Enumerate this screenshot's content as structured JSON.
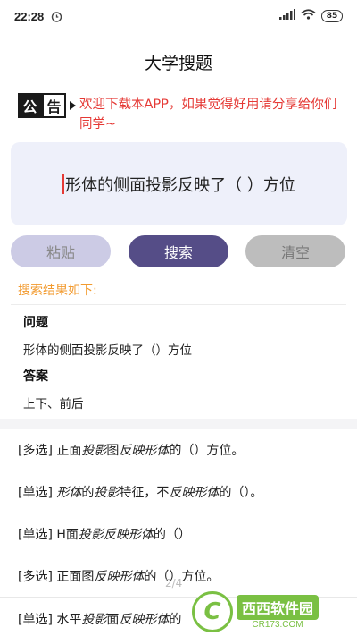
{
  "status_bar": {
    "time": "22:28",
    "battery": "85",
    "icons": [
      "alarm-icon",
      "signal-icon",
      "wifi-icon",
      "battery-icon"
    ]
  },
  "title": "大学搜题",
  "notice": {
    "badge_left": "公",
    "badge_right": "告",
    "text": "欢迎下载本APP，如果觉得好用请分享给你们同学~"
  },
  "query": {
    "text": "形体的侧面投影反映了（    ）方位"
  },
  "buttons": {
    "paste": "粘贴",
    "search": "搜索",
    "clear": "清空"
  },
  "results": {
    "header": "搜索结果如下:",
    "question_label": "问题",
    "question_text": "形体的侧面投影反映了（）方位",
    "answer_label": "答案",
    "answer_text": "上下、前后"
  },
  "related": [
    {
      "tag": "[多选]",
      "parts": [
        [
          "正面",
          false
        ],
        [
          "投影",
          true
        ],
        [
          "图",
          false
        ],
        [
          "反映形体",
          true
        ],
        [
          "的（）方位。",
          false
        ]
      ]
    },
    {
      "tag": "[单选]",
      "parts": [
        [
          "形体",
          true
        ],
        [
          "的",
          false
        ],
        [
          "投影",
          true
        ],
        [
          "特征，不",
          false
        ],
        [
          "反映形体",
          true
        ],
        [
          "的（）。",
          false
        ]
      ]
    },
    {
      "tag": "[单选]",
      "parts": [
        [
          "H面",
          false
        ],
        [
          "投影反映形体",
          true
        ],
        [
          "的（）",
          false
        ]
      ]
    },
    {
      "tag": "[多选]",
      "parts": [
        [
          "正面图",
          false
        ],
        [
          "反映形体",
          true
        ],
        [
          "的（）方位。",
          false
        ]
      ]
    },
    {
      "tag": "[单选]",
      "parts": [
        [
          "水平",
          false
        ],
        [
          "投影",
          true
        ],
        [
          "面",
          false
        ],
        [
          "反映形体",
          true
        ],
        [
          "的",
          false
        ]
      ]
    }
  ],
  "pager": "2/4",
  "watermark": {
    "logo": "C",
    "main": "西西软件园",
    "sub": "CR173.COM"
  },
  "colors": {
    "accent": "#554d87",
    "notice_red": "#e53935",
    "result_orange": "#f29a2e"
  }
}
